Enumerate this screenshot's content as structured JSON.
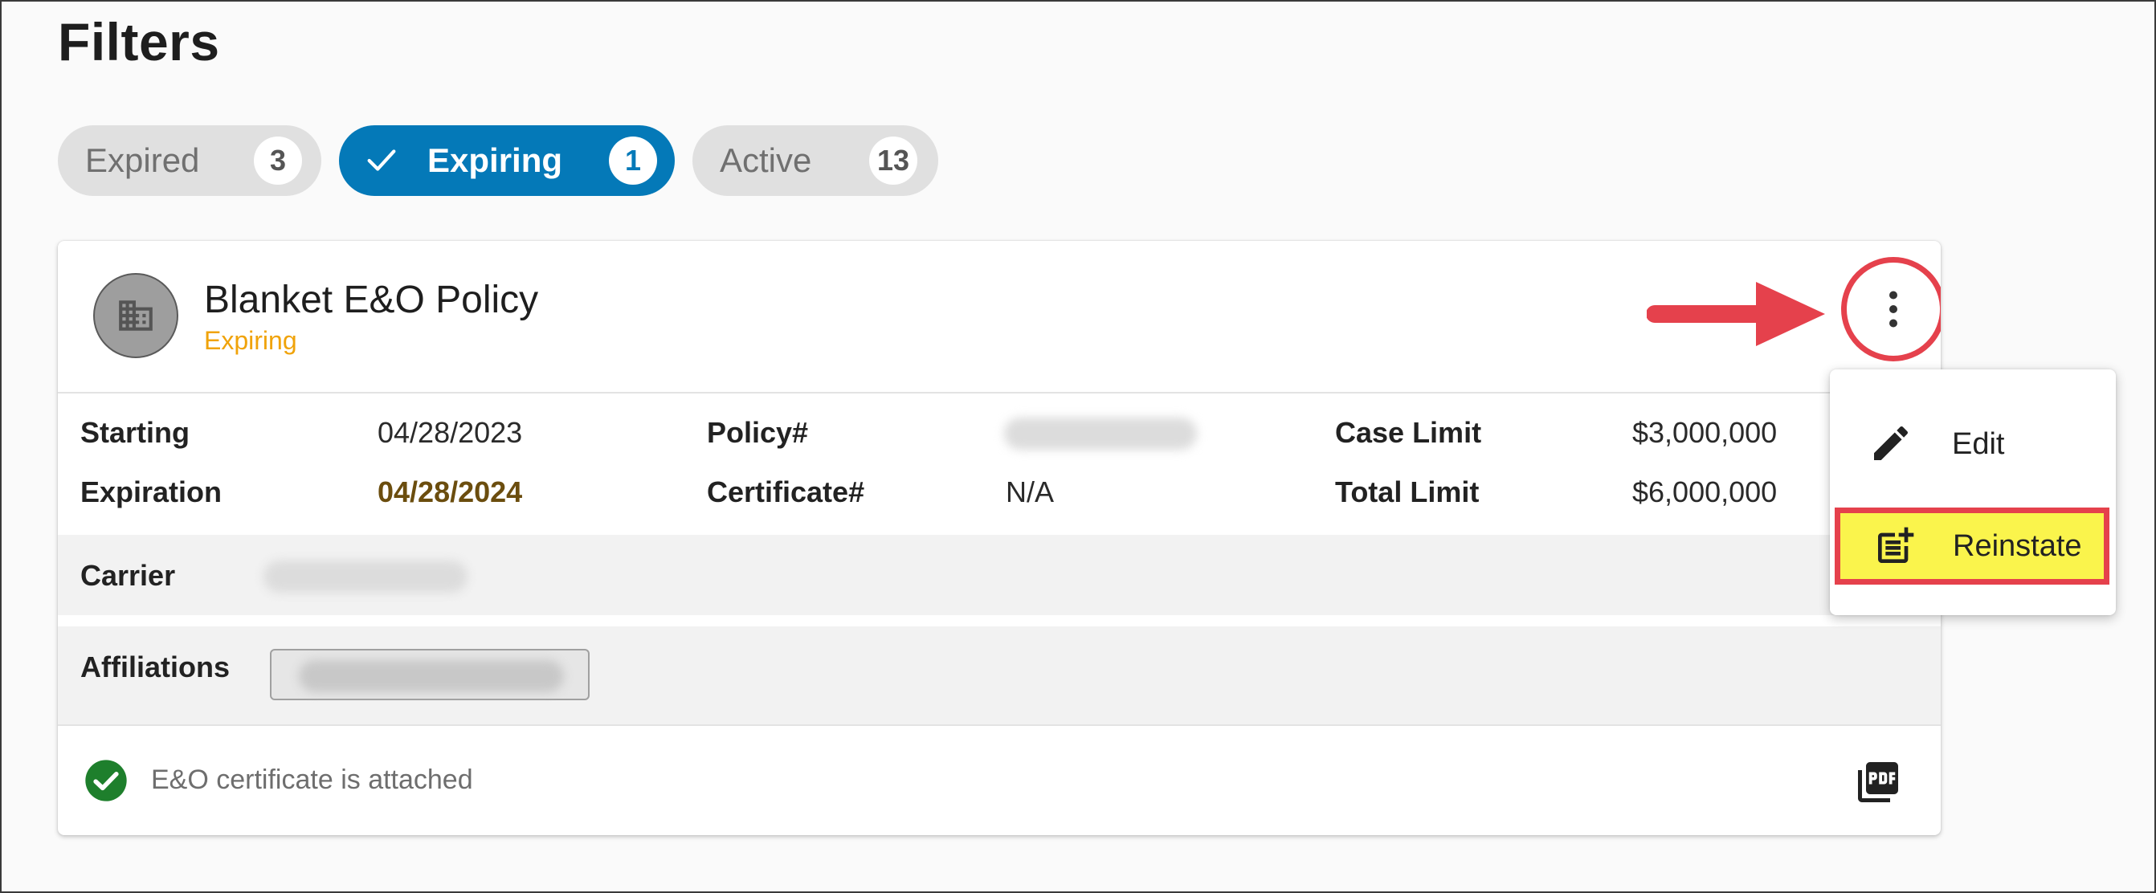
{
  "page": {
    "title": "Filters"
  },
  "filters": [
    {
      "label": "Expired",
      "count": "3",
      "selected": false
    },
    {
      "label": "Expiring",
      "count": "1",
      "selected": true
    },
    {
      "label": "Active",
      "count": "13",
      "selected": false
    }
  ],
  "policy": {
    "avatar_icon": "building-icon",
    "title": "Blanket E&O Policy",
    "status": "Expiring",
    "fields": {
      "starting_label": "Starting",
      "starting_value": "04/28/2023",
      "expiration_label": "Expiration",
      "expiration_value": "04/28/2024",
      "policy_label": "Policy#",
      "certificate_label": "Certificate#",
      "certificate_value": "N/A",
      "case_limit_label": "Case Limit",
      "case_limit_value": "$3,000,000",
      "total_limit_label": "Total Limit",
      "total_limit_value": "$6,000,000",
      "carrier_label": "Carrier",
      "affiliations_label": "Affiliations"
    },
    "certificate_status": "E&O certificate is attached"
  },
  "menu": {
    "items": [
      {
        "label": "Edit",
        "icon": "pencil-icon"
      },
      {
        "label": "Reinstate",
        "icon": "note-add-icon"
      }
    ]
  },
  "colors": {
    "accent": "#0479b8",
    "status_expiring": "#f0a30a",
    "annotation": "#e5414c",
    "highlight": "#faf44c",
    "success": "#1e7f2c"
  }
}
